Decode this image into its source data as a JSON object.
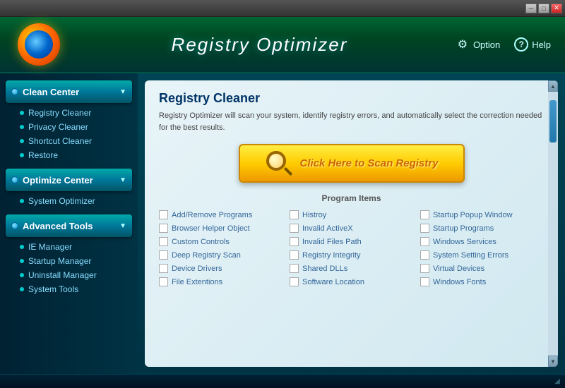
{
  "titlebar": {
    "min_label": "─",
    "max_label": "□",
    "close_label": "✕"
  },
  "header": {
    "title": "Registry Optimizer",
    "nav": [
      {
        "id": "option",
        "icon": "⚙",
        "label": "Option"
      },
      {
        "id": "help",
        "icon": "?",
        "label": "Help"
      }
    ]
  },
  "sidebar": {
    "sections": [
      {
        "id": "clean-center",
        "label": "Clean Center",
        "items": [
          {
            "id": "registry-cleaner",
            "label": "Registry Cleaner"
          },
          {
            "id": "privacy-cleaner",
            "label": "Privacy Cleaner"
          },
          {
            "id": "shortcut-cleaner",
            "label": "Shortcut Cleaner"
          },
          {
            "id": "restore",
            "label": "Restore"
          }
        ]
      },
      {
        "id": "optimize-center",
        "label": "Optimize Center",
        "items": [
          {
            "id": "system-optimizer",
            "label": "System Optimizer"
          }
        ]
      },
      {
        "id": "advanced-tools",
        "label": "Advanced Tools",
        "items": [
          {
            "id": "ie-manager",
            "label": "IE Manager"
          },
          {
            "id": "startup-manager",
            "label": "Startup Manager"
          },
          {
            "id": "uninstall-manager",
            "label": "Uninstall Manager"
          },
          {
            "id": "system-tools",
            "label": "System Tools"
          }
        ]
      }
    ]
  },
  "content": {
    "title": "Registry Cleaner",
    "description": "Registry Optimizer will scan your system, identify registry errors, and automatically\nselect the correction needed for the best results.",
    "scan_button": "Click Here to Scan Registry",
    "program_items_header": "Program Items",
    "items": [
      {
        "id": "add-remove",
        "label": "Add/Remove Programs"
      },
      {
        "id": "history",
        "label": "Histroy"
      },
      {
        "id": "startup-popup",
        "label": "Startup Popup Window"
      },
      {
        "id": "browser-helper",
        "label": "Browser Helper Object"
      },
      {
        "id": "invalid-activex",
        "label": "Invalid ActiveX"
      },
      {
        "id": "startup-programs",
        "label": "Startup Programs"
      },
      {
        "id": "custom-controls",
        "label": "Custom Controls"
      },
      {
        "id": "invalid-files",
        "label": "Invalid Files Path"
      },
      {
        "id": "windows-services",
        "label": "Windows Services"
      },
      {
        "id": "deep-registry",
        "label": "Deep Registry Scan"
      },
      {
        "id": "registry-integrity",
        "label": "Registry Integrity"
      },
      {
        "id": "system-setting",
        "label": "System Setting Errors"
      },
      {
        "id": "device-drivers",
        "label": "Device Drivers"
      },
      {
        "id": "shared-dlls",
        "label": "Shared DLLs"
      },
      {
        "id": "virtual-devices",
        "label": "Virtual Devices"
      },
      {
        "id": "file-extentions",
        "label": "File Extentions"
      },
      {
        "id": "software-location",
        "label": "Software Location"
      },
      {
        "id": "windows-fonts",
        "label": "Windows Fonts"
      }
    ]
  }
}
